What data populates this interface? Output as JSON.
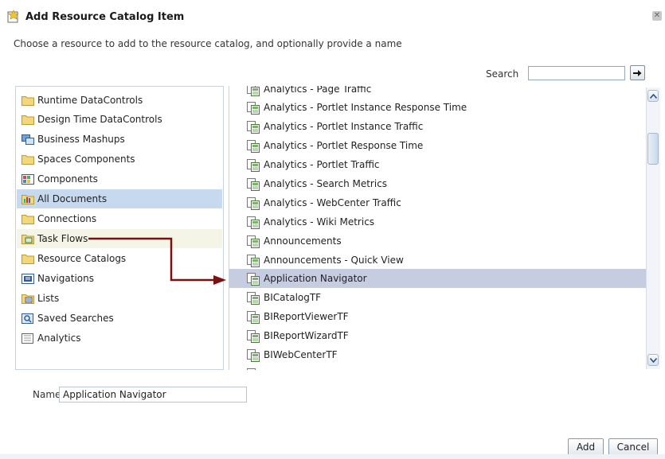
{
  "dialog": {
    "title": "Add Resource Catalog Item",
    "close_glyph": "✕",
    "instructions": "Choose a resource to add to the resource catalog, and optionally provide a name"
  },
  "search": {
    "label": "Search",
    "value": "",
    "go_icon": "arrow-right-icon"
  },
  "categories": [
    {
      "label": "Runtime DataControls",
      "icon": "folder-icon"
    },
    {
      "label": "Design Time DataControls",
      "icon": "folder-icon"
    },
    {
      "label": "Business Mashups",
      "icon": "mashup-icon"
    },
    {
      "label": "Spaces Components",
      "icon": "folder-icon"
    },
    {
      "label": "Components",
      "icon": "components-icon"
    },
    {
      "label": "All Documents",
      "icon": "documents-icon",
      "state": "selected"
    },
    {
      "label": "Connections",
      "icon": "folder-icon"
    },
    {
      "label": "Task Flows",
      "icon": "taskflow-icon",
      "state": "hover"
    },
    {
      "label": "Resource Catalogs",
      "icon": "folder-icon"
    },
    {
      "label": "Navigations",
      "icon": "navigation-icon"
    },
    {
      "label": "Lists",
      "icon": "list-icon"
    },
    {
      "label": "Saved Searches",
      "icon": "saved-search-icon"
    },
    {
      "label": "Analytics",
      "icon": "analytics-icon"
    }
  ],
  "resources": [
    {
      "label": "Analytics - Page Traffic",
      "partial": "top"
    },
    {
      "label": "Analytics - Portlet Instance Response Time"
    },
    {
      "label": "Analytics - Portlet Instance Traffic"
    },
    {
      "label": "Analytics - Portlet Response Time"
    },
    {
      "label": "Analytics - Portlet Traffic"
    },
    {
      "label": "Analytics - Search Metrics"
    },
    {
      "label": "Analytics - WebCenter Traffic"
    },
    {
      "label": "Analytics - Wiki Metrics"
    },
    {
      "label": "Announcements"
    },
    {
      "label": "Announcements - Quick View"
    },
    {
      "label": "Application Navigator",
      "state": "selected"
    },
    {
      "label": "BICatalogTF"
    },
    {
      "label": "BIReportViewerTF"
    },
    {
      "label": "BIReportWizardTF"
    },
    {
      "label": "BIWebCenterTF"
    },
    {
      "label": "",
      "partial": "bottom"
    }
  ],
  "name_field": {
    "label": "Name",
    "value": "Application Navigator"
  },
  "buttons": {
    "add": "Add",
    "cancel": "Cancel"
  },
  "colors": {
    "selected_left": "#c7d9ee",
    "selected_right": "#c7cde1",
    "connector": "#7a1010"
  }
}
